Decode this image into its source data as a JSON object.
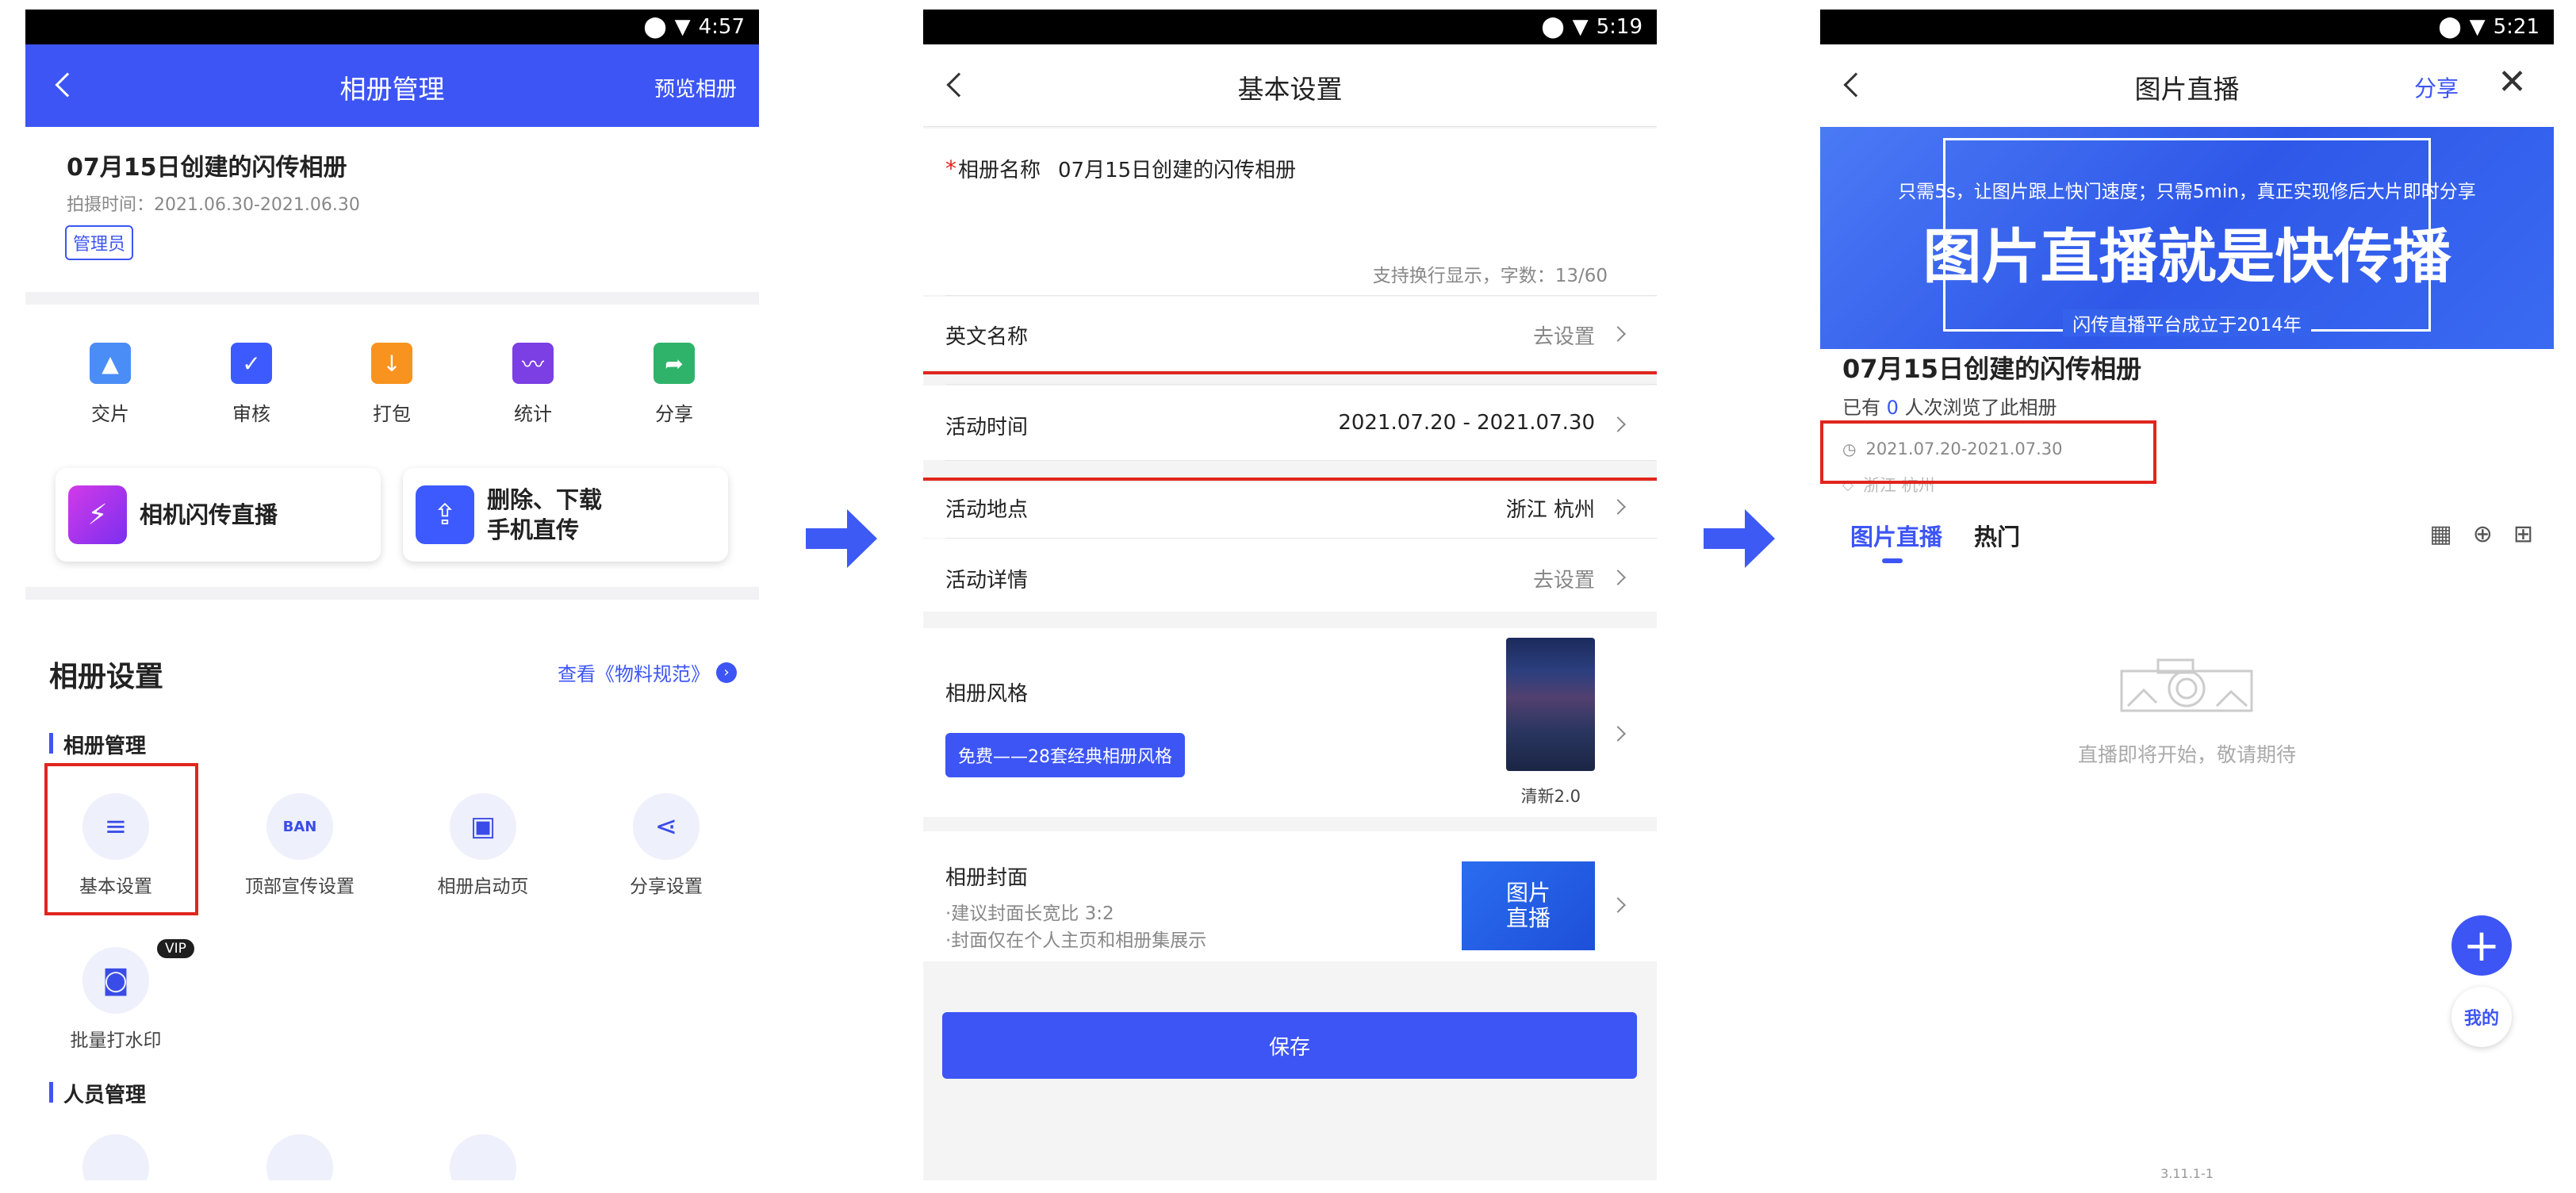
{
  "screen1": {
    "time": "4:57",
    "title": "相册管理",
    "preview": "预览相册",
    "album_name": "07月15日创建的闪传相册",
    "shoot_time": "拍摄时间：2021.06.30-2021.06.30",
    "role_badge": "管理员",
    "quick_actions": [
      {
        "label": "交片",
        "icon": "image-upload-icon",
        "color": "#4a8df6"
      },
      {
        "label": "审核",
        "icon": "clipboard-check-icon",
        "color": "#3d5afe"
      },
      {
        "label": "打包",
        "icon": "folder-download-icon",
        "color": "#f7931e"
      },
      {
        "label": "统计",
        "icon": "monitor-chart-icon",
        "color": "#7b3fe4"
      },
      {
        "label": "分享",
        "icon": "share-arrow-icon",
        "color": "#2fb36b"
      }
    ],
    "cards": [
      {
        "label": "相机闪传直播",
        "icon": "lightning-icon",
        "color": "#a52ce8"
      },
      {
        "line1": "删除、下载",
        "line2": "手机直传",
        "icon": "phone-upload-icon",
        "color": "#3d5afe"
      }
    ],
    "settings_title": "相册设置",
    "material_link": "查看《物料规范》",
    "group1": "相册管理",
    "settings": [
      {
        "label": "基本设置",
        "icon": "list-icon"
      },
      {
        "label": "顶部宣传设置",
        "icon": "banner-icon"
      },
      {
        "label": "相册启动页",
        "icon": "image-icon"
      },
      {
        "label": "分享设置",
        "icon": "share-nodes-icon"
      }
    ],
    "watermark": {
      "label": "批量打水印",
      "badge": "VIP",
      "icon": "camera-watermark-icon"
    },
    "group2": "人员管理"
  },
  "screen2": {
    "time": "5:19",
    "title": "基本设置",
    "required_mark": "*",
    "name_label": "相册名称",
    "name_value": "07月15日创建的闪传相册",
    "name_hint": "支持换行显示，字数：13/60",
    "rows": [
      {
        "label": "英文名称",
        "value": "去设置"
      },
      {
        "label": "活动时间",
        "value": "2021.07.20 - 2021.07.30"
      },
      {
        "label": "活动地点",
        "value": "浙江 杭州"
      },
      {
        "label": "活动详情",
        "value": "去设置"
      }
    ],
    "style_label": "相册风格",
    "style_tag": "免费——28套经典相册风格",
    "style_thumb_caption": "清新2.0",
    "cover_label": "相册封面",
    "cover_hint1": "·建议封面长宽比 3:2",
    "cover_hint2": "·封面仅在个人主页和相册集展示",
    "cover_thumb": "图片\n直播",
    "save": "保存"
  },
  "screen3": {
    "time": "5:21",
    "title": "图片直播",
    "share": "分享",
    "banner_top": "只需5s，让图片跟上快门速度；只需5min，真正实现修后大片即时分享",
    "banner_main": "图片直播就是快传播",
    "banner_bottom": "闪传直播平台成立于2014年",
    "album_name": "07月15日创建的闪传相册",
    "viewers_prefix": "已有 ",
    "viewers_count": "0",
    "viewers_suffix": " 人次浏览了此相册",
    "date": "2021.07.20-2021.07.30",
    "location": "浙江 杭州",
    "tabs": [
      "图片直播",
      "热门"
    ],
    "empty_text": "直播即将开始，敬请期待",
    "mine": "我的",
    "version": "3.11.1-1"
  },
  "colors": {
    "accent": "#3d55f5",
    "red": "#e0261d"
  }
}
